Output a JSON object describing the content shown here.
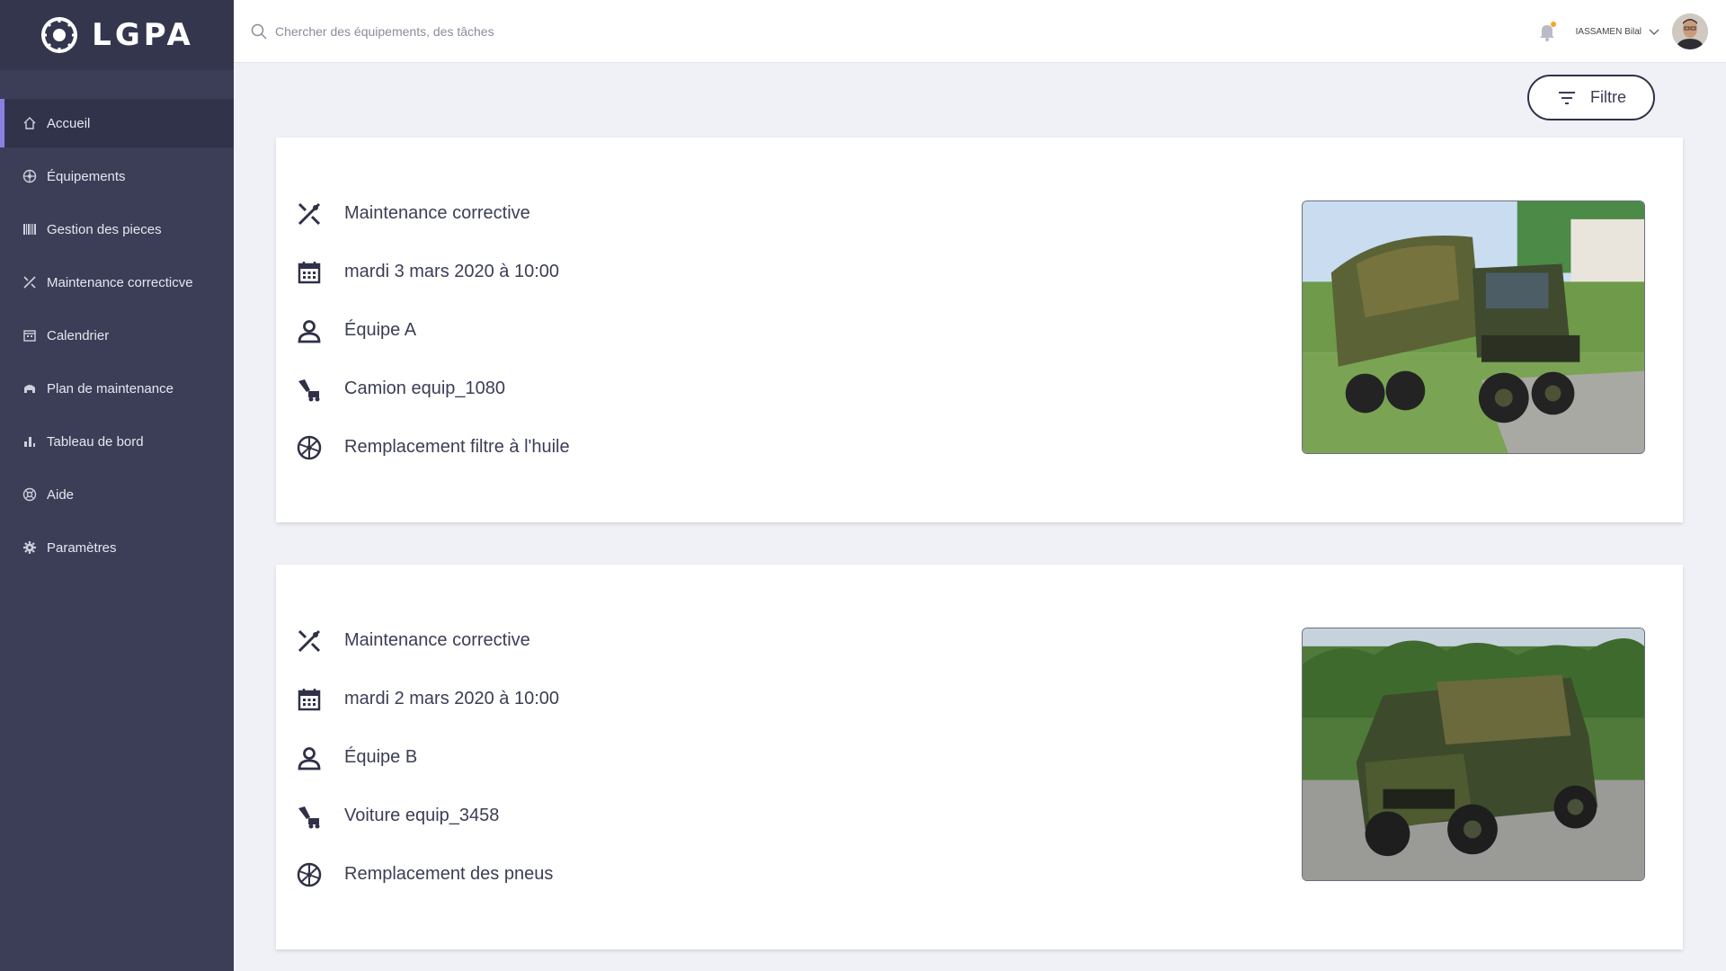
{
  "app": {
    "logo_text": "LGPA"
  },
  "sidebar": {
    "items": [
      {
        "label": "Accueil",
        "icon": "home-icon",
        "active": true
      },
      {
        "label": "Équipements",
        "icon": "wheel-icon"
      },
      {
        "label": "Gestion des pieces",
        "icon": "barcode-icon"
      },
      {
        "label": "Maintenance correcticve",
        "icon": "tools-icon"
      },
      {
        "label": "Calendrier",
        "icon": "calendar-icon"
      },
      {
        "label": "Plan de maintenance",
        "icon": "vehicle-icon"
      },
      {
        "label": "Tableau de bord",
        "icon": "bar-chart-icon"
      },
      {
        "label": "Aide",
        "icon": "help-icon"
      },
      {
        "label": "Paramètres",
        "icon": "gear-icon"
      }
    ]
  },
  "header": {
    "search_placeholder": "Chercher des équipements, des tâches",
    "user_name": "IASSAMEN Bilal",
    "notification_dot_color": "#f4a62a"
  },
  "filter": {
    "label": "Filtre"
  },
  "cards": [
    {
      "type": "Maintenance corrective",
      "date": "mardi 3 mars 2020 à 10:00",
      "team": "Équipe A",
      "equipment": "Camion equip_1080",
      "task": "Remplacement filtre à l'huile",
      "photo": "military-truck-photo"
    },
    {
      "type": "Maintenance corrective",
      "date": "mardi 2 mars 2020 à 10:00",
      "team": "Équipe B",
      "equipment": "Voiture equip_3458",
      "task": "Remplacement des pneus",
      "photo": "military-jeep-photo"
    }
  ],
  "colors": {
    "sidebar_bg": "#3c3e58",
    "sidebar_active_bg": "#31334a",
    "active_accent": "#8b80e0",
    "page_bg": "#eff1f6"
  }
}
